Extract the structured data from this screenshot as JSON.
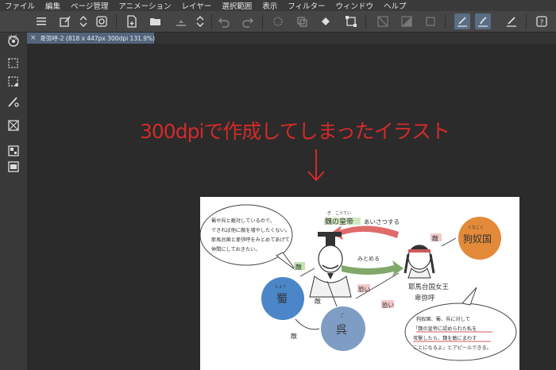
{
  "menu": {
    "items": [
      "ファイル",
      "編集",
      "ページ管理",
      "アニメーション",
      "レイヤー",
      "選択範囲",
      "表示",
      "フィルター",
      "ウィンドウ",
      "ヘルプ"
    ]
  },
  "toolbar": {
    "icons": [
      "hamburger-menu-icon",
      "new-icon",
      "stepper-icon",
      "rotate-icon",
      "new-file-icon",
      "open-folder-icon",
      "save-icon",
      "undo-icon",
      "redo-icon",
      "selection-icon",
      "crop-icon",
      "reference-icon",
      "fill-icon",
      "transform-icon",
      "pen-icon",
      "brush-icon",
      "ruler-icon",
      "help-icon"
    ]
  },
  "tab": {
    "close": "×",
    "title": "卑弥呼-2 (818 x 447px 300dpi 131.9%)"
  },
  "canvas": {
    "annotation": "300dpiで作成してしまったイラスト",
    "arrow": "↓"
  },
  "illustration": {
    "speech_left": [
      "蜀や呉と敵対しているので、",
      "できれば他に敵を増やしたくない。",
      "耶馬台国と卑弥呼をみとめてあげて",
      "仲間にしておきたい。"
    ],
    "wei_ruby": "ぎ　こうてい",
    "wei_label": "魏の皇帝",
    "aisatsu": "あいさつする",
    "mitomeru": "みとめる",
    "teki1": "敵",
    "teki2": "敵",
    "teki3": "敵",
    "teki4": "敵",
    "kunakoku_ruby": "くなこく",
    "kunakoku": "狗奴国",
    "yamatai_label": "耶馬台国女王",
    "himiko_label": "卑弥呼",
    "shoku_ruby": "しょく",
    "shoku": "蜀",
    "go_ruby": "ご",
    "go": "呉",
    "osoi1": "恐い",
    "osoi2": "恐い",
    "speech_right": [
      "狗奴国、蜀、呉に対して",
      "「魏の皇帝に認められた私を",
      "攻撃したら、魏を敵にまわす",
      "ことになるよ」とアピールできる。"
    ]
  },
  "colors": {
    "annotation": "#d42a2a",
    "tab_active": "#52657c",
    "kunakoku_circle": "#e38a3a",
    "shoku_circle": "#4a86c8",
    "go_circle": "#7f9dc4",
    "red_arrow": "#e06a6a",
    "green_arrow": "#7fa86a"
  }
}
